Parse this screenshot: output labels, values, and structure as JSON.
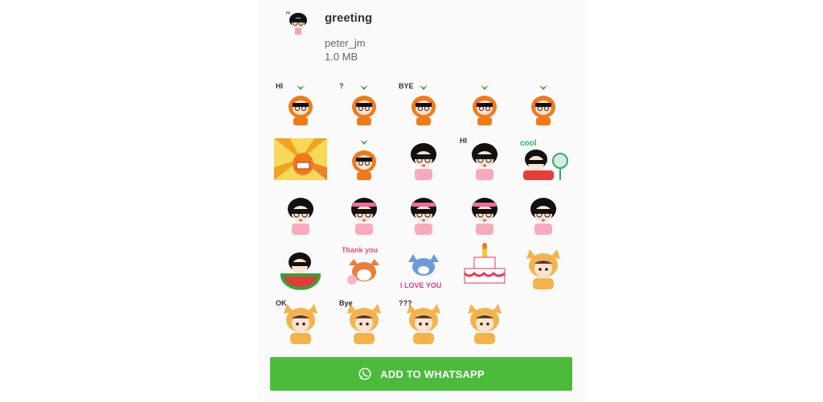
{
  "pack": {
    "title": "greeting",
    "author": "peter_jm",
    "size": "1.0 MB",
    "thumbnail_icon": "girl-hi-sticker-icon"
  },
  "stickers": [
    {
      "name": "carrot-girl-hi-sticker",
      "caption": "HI",
      "style": "carrot"
    },
    {
      "name": "carrot-girl-question-sticker",
      "caption": "?",
      "style": "carrot"
    },
    {
      "name": "carrot-girl-bye-sticker",
      "caption": "BYE",
      "style": "carrot"
    },
    {
      "name": "carrot-girl-peek-sticker",
      "caption": "",
      "style": "carrot"
    },
    {
      "name": "carrot-girl-run-sticker",
      "caption": "",
      "style": "carrot-small"
    },
    {
      "name": "carrot-sunburst-sticker",
      "caption": "",
      "style": "sunburst"
    },
    {
      "name": "carrot-girl-cry-sticker",
      "caption": "",
      "style": "carrot"
    },
    {
      "name": "girl-pink-bow-sticker",
      "caption": "",
      "style": "girl"
    },
    {
      "name": "girl-hi-sticker",
      "caption": "HI",
      "style": "girl"
    },
    {
      "name": "girl-cool-fan-sticker",
      "caption": "cool",
      "style": "girl-fan"
    },
    {
      "name": "girl-smile-sticker",
      "caption": "",
      "style": "girl"
    },
    {
      "name": "girl-pink-ears-sticker",
      "caption": "",
      "style": "girl-pink"
    },
    {
      "name": "girl-love-sticker",
      "caption": "",
      "style": "girl-pink"
    },
    {
      "name": "girl-headband-sticker",
      "caption": "",
      "style": "girl-pink"
    },
    {
      "name": "girl-pout-sticker",
      "caption": "",
      "style": "girl"
    },
    {
      "name": "girl-watermelon-sticker",
      "caption": "",
      "style": "watermelon"
    },
    {
      "name": "fox-thank-you-sticker",
      "caption": "Thank you",
      "style": "fox"
    },
    {
      "name": "wolf-i-love-you-sticker",
      "caption": "I LOVE YOU",
      "style": "wolf"
    },
    {
      "name": "birthday-cake-sticker",
      "caption": "",
      "style": "cake"
    },
    {
      "name": "shiba-hood-smoke-sticker",
      "caption": "",
      "style": "shiba"
    },
    {
      "name": "shiba-ok-sticker",
      "caption": "OK",
      "style": "shiba"
    },
    {
      "name": "shiba-bye-sticker",
      "caption": "Bye",
      "style": "shiba"
    },
    {
      "name": "shiba-question-sticker",
      "caption": "???",
      "style": "shiba"
    },
    {
      "name": "shiba-dots-sticker",
      "caption": "",
      "style": "shiba"
    }
  ],
  "actions": {
    "add_to_whatsapp_label": "ADD TO WHATSAPP",
    "add_to_whatsapp_icon": "whatsapp-icon",
    "button_color": "#4cbb3c"
  }
}
